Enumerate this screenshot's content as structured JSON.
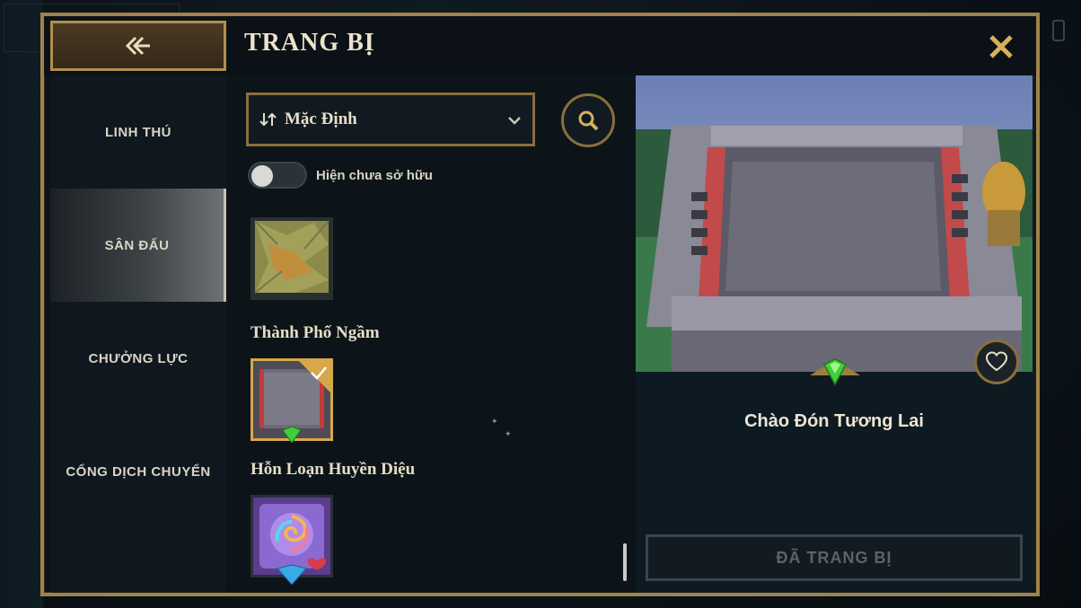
{
  "header": {
    "title": "TRANG BỊ"
  },
  "sidebar": {
    "items": [
      {
        "label": "LINH THÚ",
        "active": false
      },
      {
        "label": "SÂN ĐẤU",
        "active": true
      },
      {
        "label": "CHƯỞNG LỰC",
        "active": false
      },
      {
        "label": "CỔNG DỊCH CHUYỂN",
        "active": false
      }
    ]
  },
  "filters": {
    "sort_label": "Mặc Định",
    "toggle_label": "Hiện chưa sở hữu",
    "toggle_on": false
  },
  "arenas": [
    {
      "name": "Thành Phố Ngầm",
      "equipped": true
    },
    {
      "name": "Hỗn Loạn Huyền Diệu",
      "equipped": false
    }
  ],
  "preview": {
    "name": "Chào Đón Tương Lai",
    "equip_label": "ĐÃ TRANG BỊ"
  },
  "colors": {
    "gold_border": "#a0834a",
    "bg": "#0c1419",
    "gem_green": "#3fcf3a",
    "gem_blue": "#3aa9e6"
  },
  "icons": [
    "back-arrow-icon",
    "close-icon",
    "sort-icon",
    "chevron-down-icon",
    "search-icon",
    "heart-icon",
    "gem-icon",
    "checkmark-icon"
  ]
}
